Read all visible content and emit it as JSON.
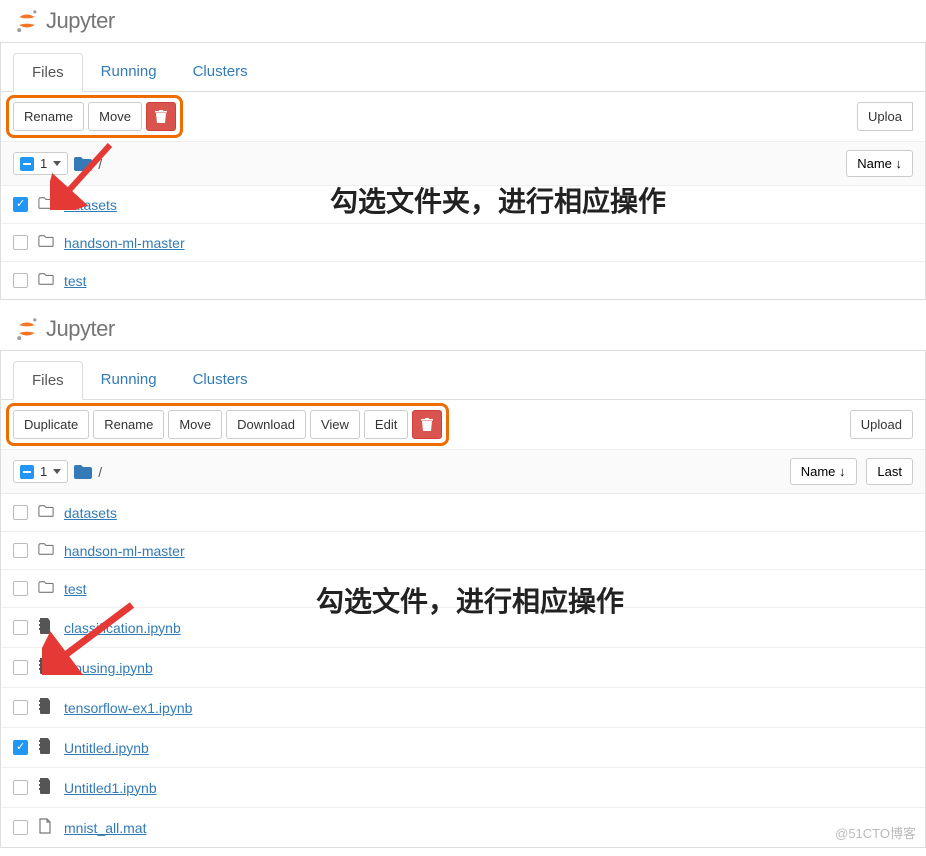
{
  "logo_text": "Jupyter",
  "tabs": {
    "files": "Files",
    "running": "Running",
    "clusters": "Clusters"
  },
  "panel1": {
    "actions": {
      "rename": "Rename",
      "move": "Move"
    },
    "upload": "Uploa",
    "selected_count": "1",
    "sort": "Name ↓",
    "crumb_slash": "/",
    "items": [
      {
        "name": "datasets",
        "type": "folder",
        "checked": true
      },
      {
        "name": "handson-ml-master",
        "type": "folder",
        "checked": false
      },
      {
        "name": "test",
        "type": "folder",
        "checked": false
      }
    ]
  },
  "panel2": {
    "actions": {
      "duplicate": "Duplicate",
      "rename": "Rename",
      "move": "Move",
      "download": "Download",
      "view": "View",
      "edit": "Edit"
    },
    "upload": "Upload",
    "selected_count": "1",
    "sort": "Name ↓",
    "last": "Last",
    "crumb_slash": "/",
    "items": [
      {
        "name": "datasets",
        "type": "folder",
        "checked": false
      },
      {
        "name": "handson-ml-master",
        "type": "folder",
        "checked": false
      },
      {
        "name": "test",
        "type": "folder",
        "checked": false
      },
      {
        "name": "classification.ipynb",
        "type": "notebook",
        "checked": false
      },
      {
        "name": "Housing.ipynb",
        "type": "notebook",
        "checked": false
      },
      {
        "name": "tensorflow-ex1.ipynb",
        "type": "notebook",
        "checked": false
      },
      {
        "name": "Untitled.ipynb",
        "type": "notebook",
        "checked": true
      },
      {
        "name": "Untitled1.ipynb",
        "type": "notebook",
        "checked": false
      },
      {
        "name": "mnist_all.mat",
        "type": "file",
        "checked": false
      }
    ]
  },
  "annotations": {
    "a1": "勾选文件夹，进行相应操作",
    "a2": "勾选文件，进行相应操作"
  },
  "watermark": "@51CTO博客"
}
